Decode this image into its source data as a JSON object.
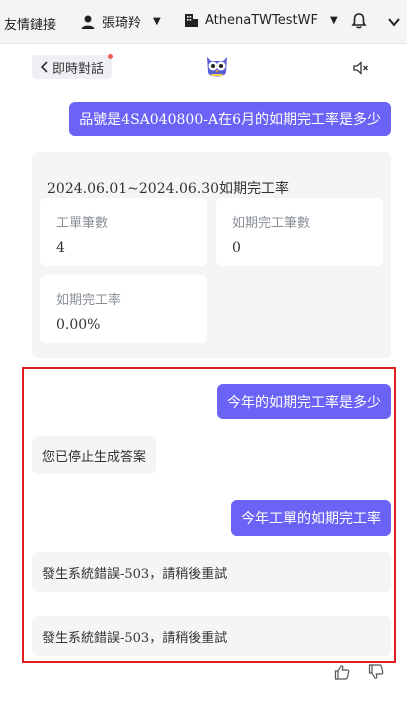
{
  "header": {
    "links_label": "友情鏈接",
    "user_name": "張琦羚",
    "company_name": "AthenaTWTestWF",
    "bell_icon": "bell-icon",
    "more_icon": "chevron-down-icon"
  },
  "chat": {
    "back_label": "即時對話",
    "assistant_icon": "owl-icon",
    "mute_icon": "speaker-mute-icon",
    "messages": [
      {
        "role": "user",
        "text": "品號是4SA040800-A在6月的如期完工率是多少"
      },
      {
        "role": "user",
        "text": "今年的如期完工率是多少"
      },
      {
        "role": "bot",
        "text": "您已停止生成答案"
      },
      {
        "role": "user",
        "text": "今年工單的如期完工率"
      },
      {
        "role": "bot",
        "text": "發生系統錯誤-503，請稍後重試"
      },
      {
        "role": "bot",
        "text": "發生系統錯誤-503，請稍後重試"
      }
    ],
    "result_card": {
      "title": "2024.06.01~2024.06.30如期完工率",
      "stats": [
        {
          "label": "工單筆數",
          "value": "4"
        },
        {
          "label": "如期完工筆數",
          "value": "0"
        },
        {
          "label": "如期完工率",
          "value": "0.00%"
        }
      ]
    },
    "feedback": {
      "like_icon": "thumbs-up-icon",
      "dislike_icon": "thumbs-down-icon"
    }
  },
  "colors": {
    "accent": "#6a63f6",
    "highlight_border": "#e02020",
    "notification_dot": "#f25c5c"
  }
}
